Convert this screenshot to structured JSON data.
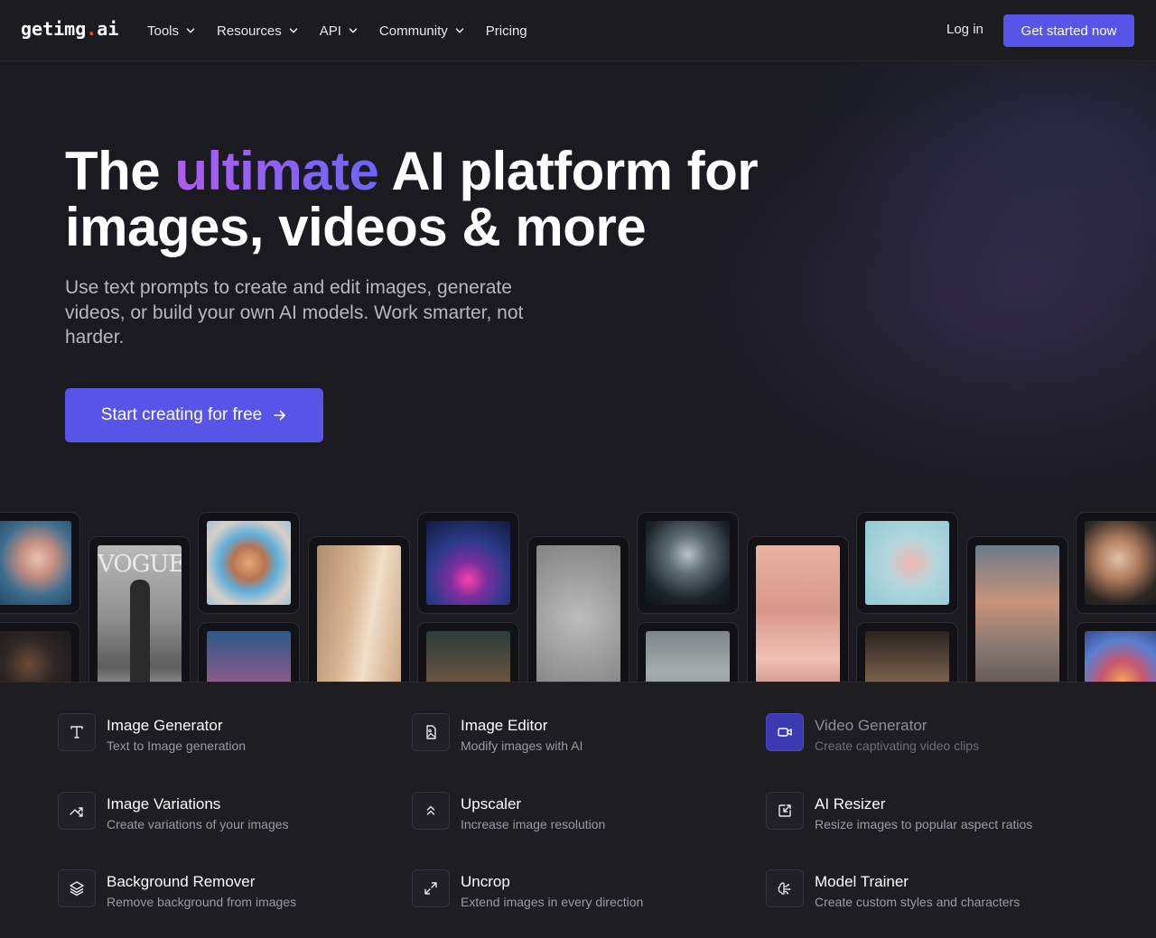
{
  "nav": {
    "logo_main": "getimg",
    "logo_dot": ".",
    "logo_tld": "ai",
    "menu": [
      {
        "label": "Tools",
        "has_dropdown": true
      },
      {
        "label": "Resources",
        "has_dropdown": true
      },
      {
        "label": "API",
        "has_dropdown": true
      },
      {
        "label": "Community",
        "has_dropdown": true
      },
      {
        "label": "Pricing",
        "has_dropdown": false
      }
    ],
    "login_label": "Log in",
    "cta_label": "Get started now"
  },
  "hero": {
    "headline_part1": "The ",
    "headline_accent": "ultimate",
    "headline_part2": " AI platform for images, videos & more",
    "subtitle": "Use text prompts to create and edit images, generate videos, or build your own AI models. Work smarter, not harder.",
    "cta_label": "Start creating for free"
  },
  "gallery": {
    "vogue_text": "VOGUE"
  },
  "tools": [
    {
      "title": "Image Generator",
      "desc": "Text to Image generation",
      "icon": "text-t-icon"
    },
    {
      "title": "Image Editor",
      "desc": "Modify images with AI",
      "icon": "image-edit-icon"
    },
    {
      "title": "Video Generator",
      "desc": "Create captivating video clips",
      "icon": "video-camera-icon"
    },
    {
      "title": "Image Variations",
      "desc": "Create variations of your images",
      "icon": "shuffle-arrows-icon"
    },
    {
      "title": "Upscaler",
      "desc": "Increase image resolution",
      "icon": "chevrons-up-icon"
    },
    {
      "title": "AI Resizer",
      "desc": "Resize images to popular aspect ratios",
      "icon": "resize-arrow-icon"
    },
    {
      "title": "Background Remover",
      "desc": "Remove background from images",
      "icon": "layers-icon"
    },
    {
      "title": "Uncrop",
      "desc": "Extend images in every direction",
      "icon": "expand-arrows-icon"
    },
    {
      "title": "Model Trainer",
      "desc": "Create custom styles and characters",
      "icon": "brain-icon"
    }
  ]
}
